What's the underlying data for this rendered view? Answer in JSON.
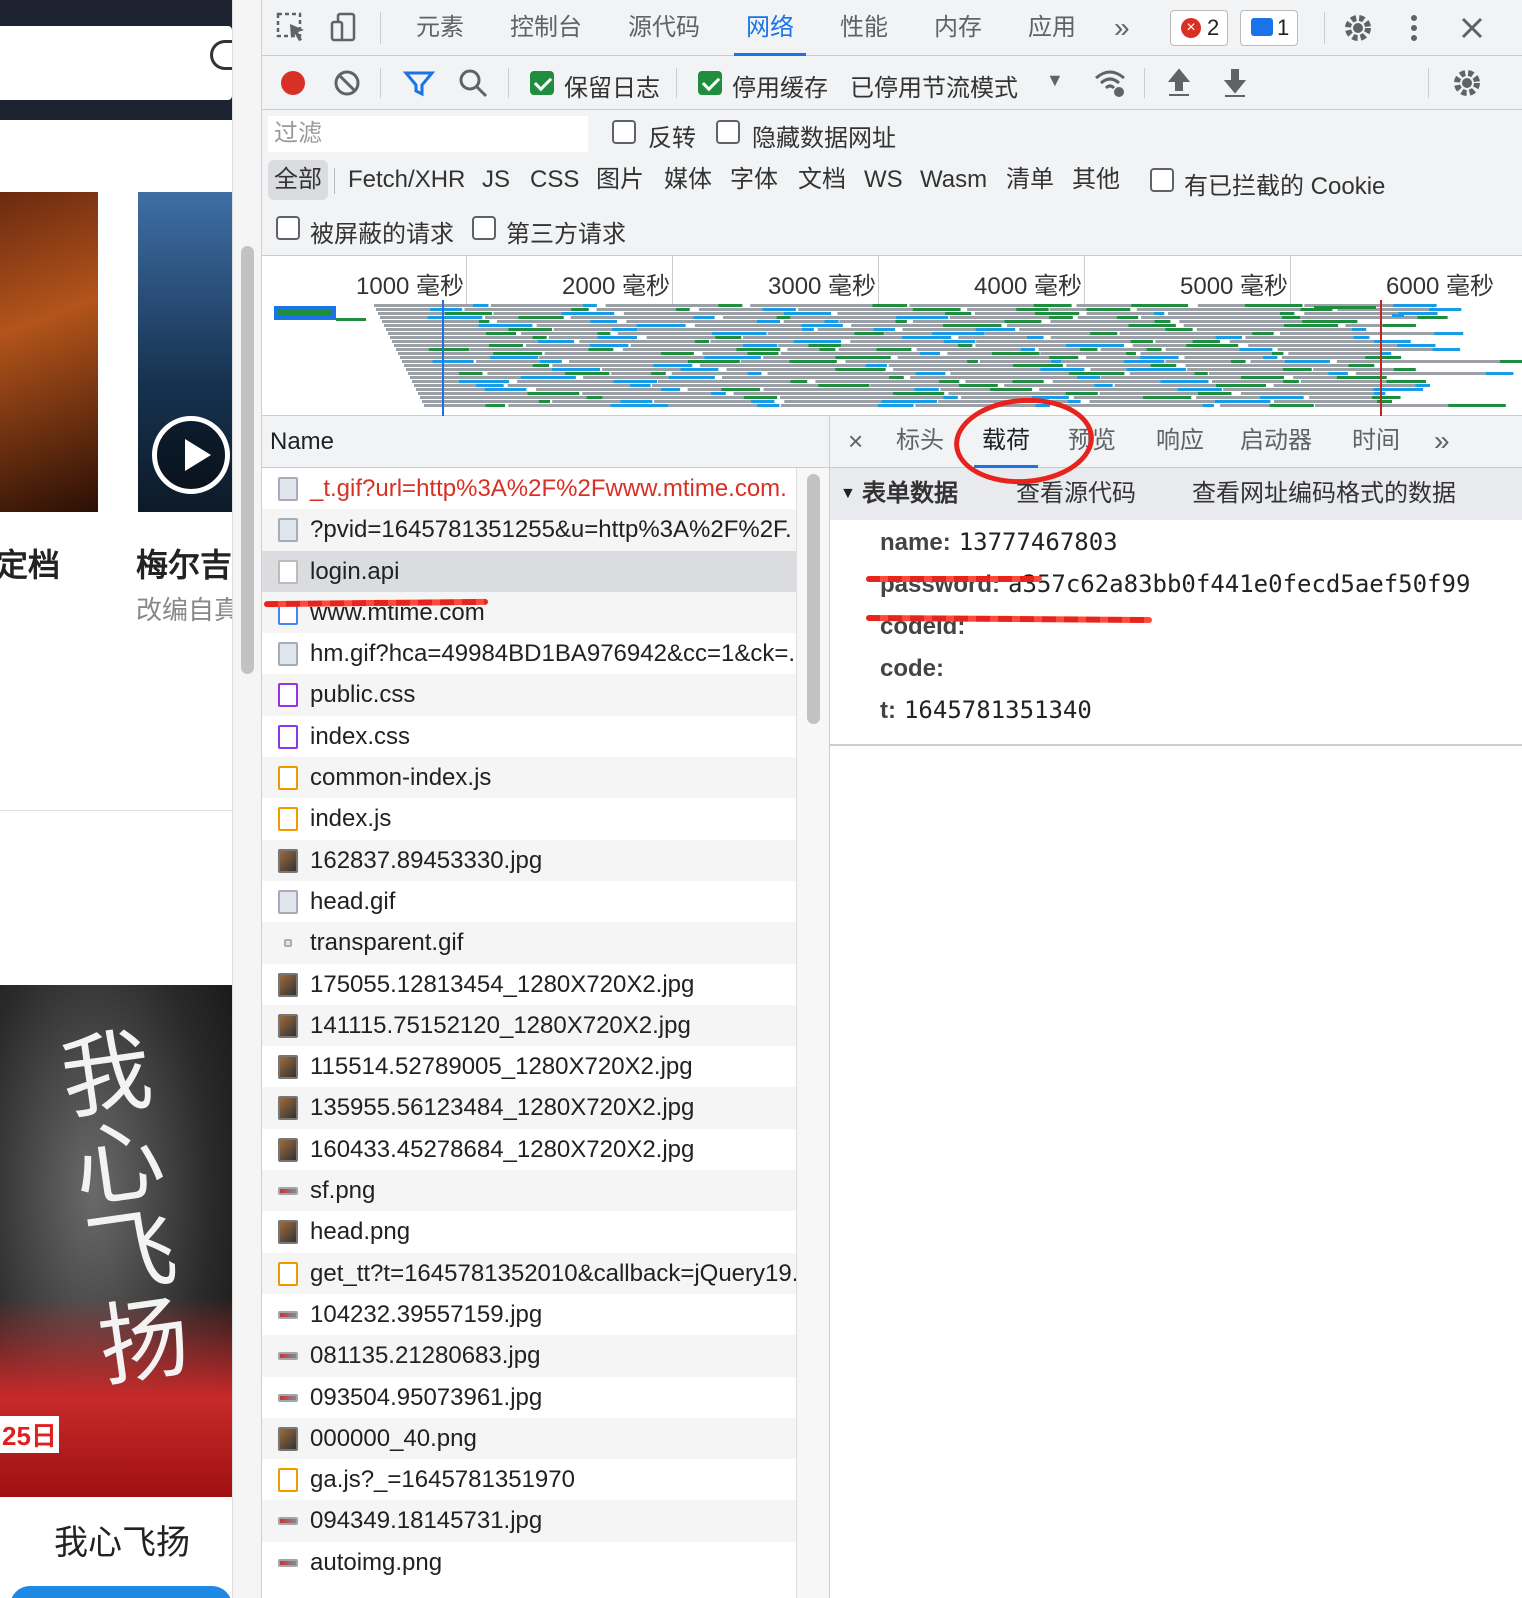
{
  "page": {
    "tile2_title": "梅尔吉",
    "tile1_title": "定档",
    "tile2_sub": "改编自真",
    "poster_title": "我心飞扬",
    "poster_calligraphy": "我心飞扬",
    "poster_date": "25日"
  },
  "devtools": {
    "tabs": [
      "元素",
      "控制台",
      "源代码",
      "网络",
      "性能",
      "内存",
      "应用"
    ],
    "active_tab": "网络",
    "more": "»",
    "errors": "2",
    "messages": "1",
    "toolbar": {
      "preserve_log": "保留日志",
      "disable_cache": "停用缓存",
      "throttle": "已停用节流模式"
    },
    "filter": {
      "placeholder": "过滤",
      "invert": "反转",
      "hide_data_urls": "隐藏数据网址",
      "types": [
        "全部",
        "Fetch/XHR",
        "JS",
        "CSS",
        "图片",
        "媒体",
        "字体",
        "文档",
        "WS",
        "Wasm",
        "清单",
        "其他"
      ],
      "blocked_cookies": "有已拦截的 Cookie",
      "blocked_requests": "被屏蔽的请求",
      "third_party": "第三方请求"
    },
    "timeline": [
      "1000 毫秒",
      "2000 毫秒",
      "3000 毫秒",
      "4000 毫秒",
      "5000 毫秒",
      "6000 毫秒"
    ],
    "requests": {
      "column": "Name",
      "rows": [
        {
          "name": "_t.gif?url=http%3A%2F%2Fwww.mtime.com.",
          "type": "gif",
          "error": true
        },
        {
          "name": "?pvid=1645781351255&u=http%3A%2F%2F.",
          "type": "gif"
        },
        {
          "name": "login.api",
          "type": "blank",
          "selected": true
        },
        {
          "name": "www.mtime.com",
          "type": "doc"
        },
        {
          "name": "hm.gif?hca=49984BD1BA976942&cc=1&ck=..",
          "type": "gif"
        },
        {
          "name": "public.css",
          "type": "css"
        },
        {
          "name": "index.css",
          "type": "css"
        },
        {
          "name": "common-index.js",
          "type": "js"
        },
        {
          "name": "index.js",
          "type": "js"
        },
        {
          "name": "162837.89453330.jpg",
          "type": "img"
        },
        {
          "name": "head.gif",
          "type": "gif"
        },
        {
          "name": "transparent.gif",
          "type": "tiny"
        },
        {
          "name": "175055.12813454_1280X720X2.jpg",
          "type": "img"
        },
        {
          "name": "141115.75152120_1280X720X2.jpg",
          "type": "img"
        },
        {
          "name": "115514.52789005_1280X720X2.jpg",
          "type": "img"
        },
        {
          "name": "135955.56123484_1280X720X2.jpg",
          "type": "img"
        },
        {
          "name": "160433.45278684_1280X720X2.jpg",
          "type": "img"
        },
        {
          "name": "sf.png",
          "type": "thin"
        },
        {
          "name": "head.png",
          "type": "img"
        },
        {
          "name": "get_tt?t=1645781352010&callback=jQuery19.",
          "type": "js"
        },
        {
          "name": "104232.39557159.jpg",
          "type": "thin"
        },
        {
          "name": "081135.21280683.jpg",
          "type": "thin"
        },
        {
          "name": "093504.95073961.jpg",
          "type": "thin"
        },
        {
          "name": "000000_40.png",
          "type": "img"
        },
        {
          "name": "ga.js?_=1645781351970",
          "type": "js"
        },
        {
          "name": "094349.18145731.jpg",
          "type": "thin"
        },
        {
          "name": "autoimg.png",
          "type": "thin"
        }
      ]
    },
    "detail": {
      "close": "×",
      "tabs": [
        "标头",
        "载荷",
        "预览",
        "响应",
        "启动器",
        "时间"
      ],
      "active_tab": "载荷",
      "more": "»",
      "section": "表单数据",
      "view_source": "查看源代码",
      "view_url_encoded": "查看网址编码格式的数据",
      "form": [
        {
          "key": "name:",
          "value": "13777467803"
        },
        {
          "key": "password:",
          "value": "a357c62a83bb0f441e0fecd5aef50f99"
        },
        {
          "key": "codeId:",
          "value": ""
        },
        {
          "key": "code:",
          "value": ""
        },
        {
          "key": "t:",
          "value": "1645781351340"
        }
      ]
    },
    "colors": {
      "accent": "#1a73e8",
      "record": "#d93025",
      "annotation": "#e8231e"
    }
  }
}
